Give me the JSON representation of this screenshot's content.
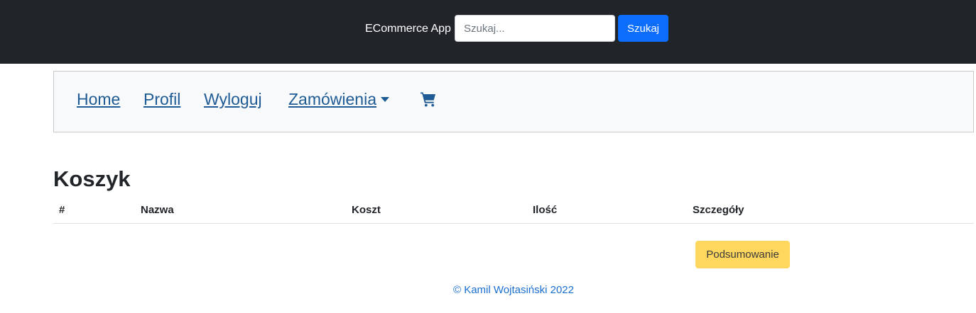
{
  "header": {
    "brand": "ECommerce App",
    "search_placeholder": "Szukaj...",
    "search_button_label": "Szukaj"
  },
  "nav": {
    "home": "Home",
    "profil": "Profil",
    "logout": "Wyloguj",
    "orders": "Zamówienia",
    "cart_icon": "shopping-cart-icon"
  },
  "page": {
    "title": "Koszyk"
  },
  "table": {
    "columns": [
      "#",
      "Nazwa",
      "Koszt",
      "Ilość",
      "Szczegóły"
    ],
    "rows": []
  },
  "summary_button_label": "Podsumowanie",
  "footer": {
    "text": "© Kamil Wojtasiński 2022"
  },
  "colors": {
    "header_bg": "#212529",
    "primary": "#0d6efd",
    "warning": "#ffd75e",
    "nav_link": "#1f5b94",
    "footer_link": "#1a6fd1"
  }
}
